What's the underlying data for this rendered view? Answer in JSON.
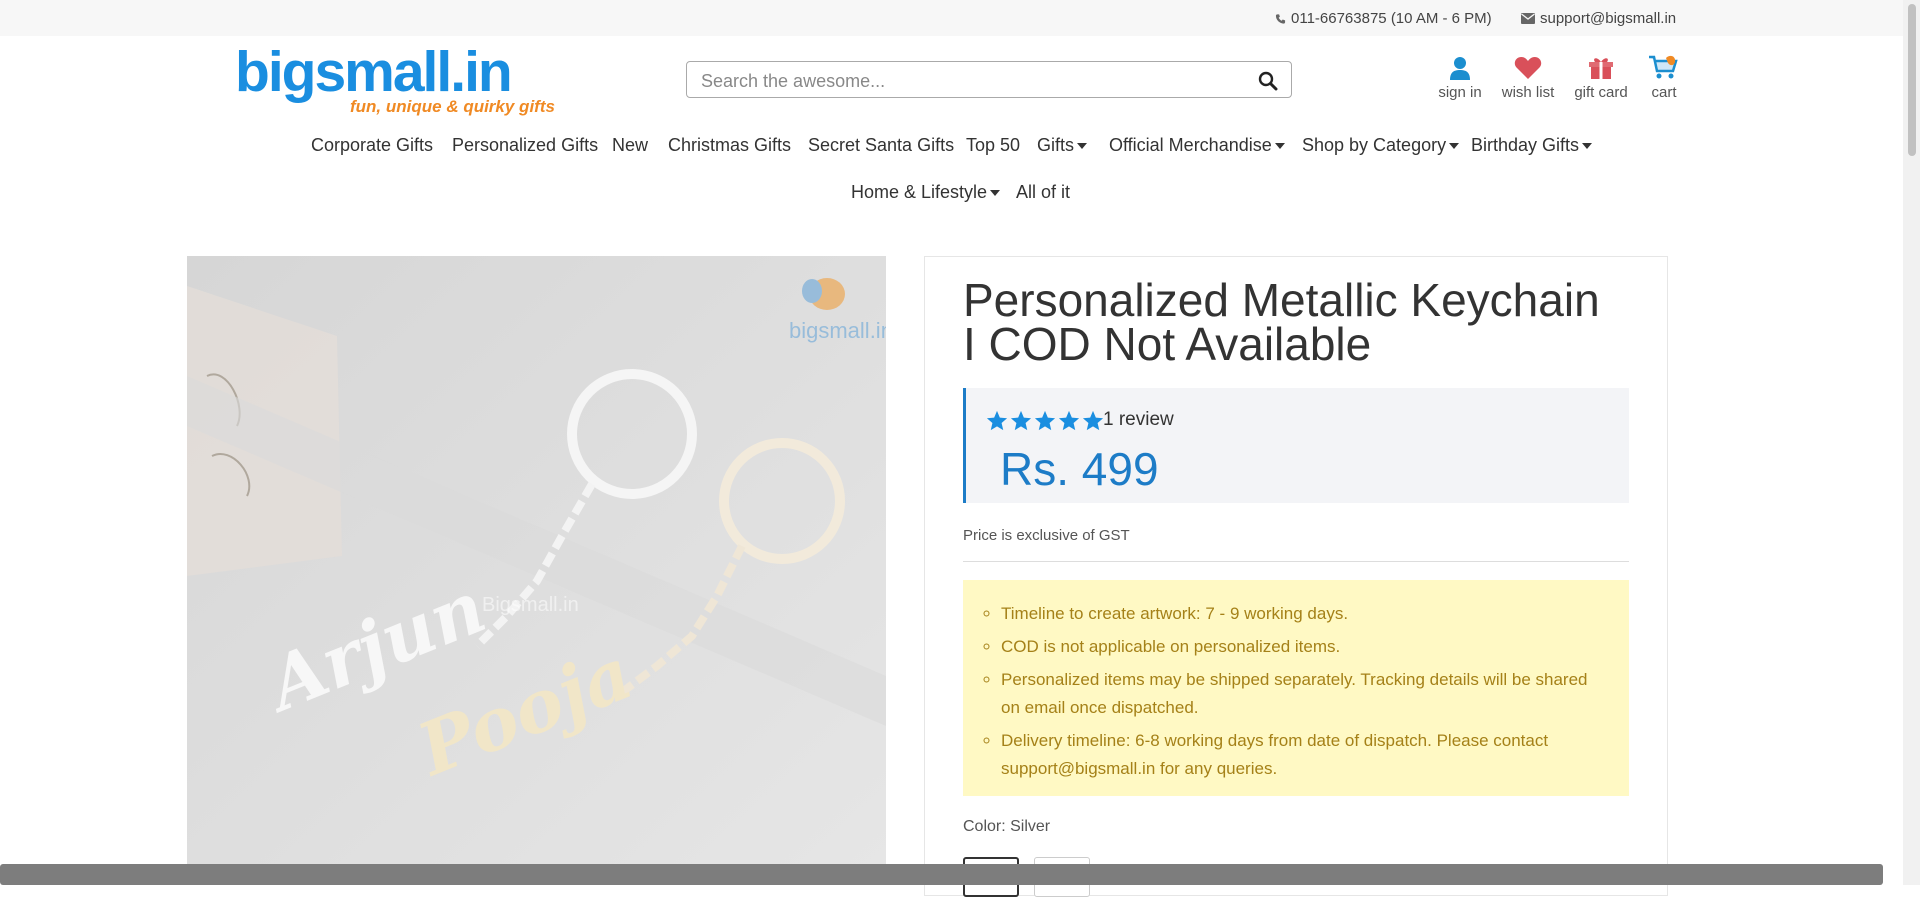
{
  "topbar": {
    "phone": "011-66763875 (10 AM - 6 PM)",
    "email": "support@bigsmall.in"
  },
  "logo": {
    "brand": "bigsmall.in",
    "tagline": "fun, unique & quirky gifts"
  },
  "search": {
    "placeholder": "Search the awesome..."
  },
  "header_icons": {
    "sign_in": "sign in",
    "wish_list": "wish list",
    "gift_card": "gift card",
    "cart": "cart"
  },
  "nav": {
    "corporate": "Corporate Gifts",
    "personalized": "Personalized Gifts",
    "new": "New",
    "christmas": "Christmas Gifts",
    "secret_santa": "Secret Santa Gifts",
    "top50": "Top 50",
    "gifts": "Gifts",
    "official": "Official Merchandise",
    "shop_by_category": "Shop by Category",
    "birthday": "Birthday Gifts",
    "home_lifestyle": "Home & Lifestyle",
    "all": "All of it"
  },
  "image": {
    "watermark_center": "Bigsmall.in",
    "watermark_logo": "bigsmall.in",
    "name1": "Arjun",
    "name2": "Pooja"
  },
  "product": {
    "title": "Personalized Metallic Keychain I COD Not Available",
    "rating": 5,
    "reviews": "1 review",
    "price": "Rs. 499",
    "gst_note": "Price is exclusive of GST",
    "notes": [
      "Timeline to create artwork: 7 - 9 working days.",
      "COD is not applicable on personalized items.",
      "Personalized items may be shipped separately. Tracking details will be shared on email once dispatched.",
      "Delivery timeline: 6-8 working days from date of dispatch. Please contact support@bigsmall.in for any queries."
    ],
    "color_label": "Color: Silver"
  },
  "colors": {
    "accent": "#1d7cc7",
    "brand_blue": "#1a8ee0",
    "brand_orange": "#f08a24",
    "star": "#1a8ee0",
    "notes_bg": "#fff9c4",
    "notes_text": "#a58118"
  }
}
